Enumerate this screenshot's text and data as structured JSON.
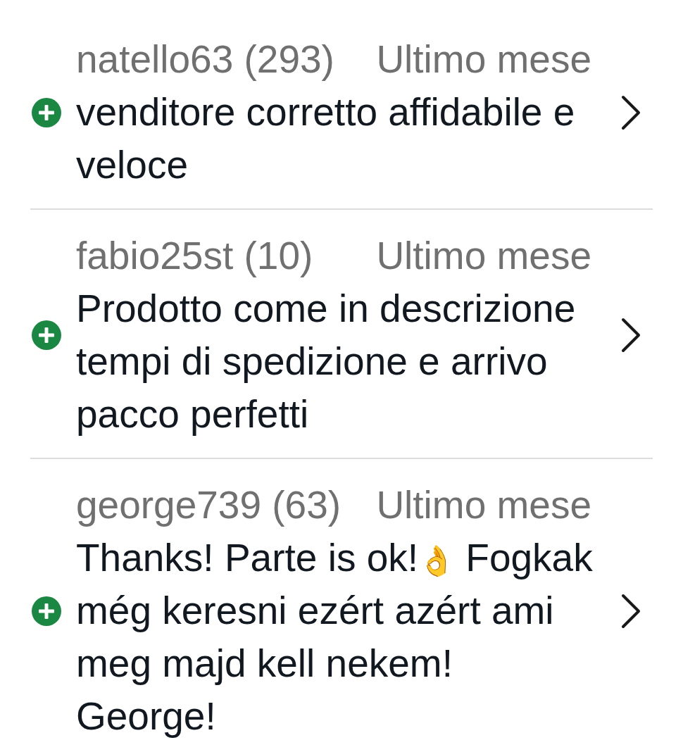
{
  "reviews": [
    {
      "positive": true,
      "user": "natello63 (293)",
      "time": "Ultimo mese",
      "comment": "venditore corretto affidabile e veloce"
    },
    {
      "positive": true,
      "user": "fabio25st (10)",
      "time": "Ultimo mese",
      "comment": "Prodotto come in descrizione tempi di spedizione e arrivo pacco perfetti"
    },
    {
      "positive": true,
      "user": "george739 (63)",
      "time": "Ultimo mese",
      "comment": "Thanks! Parte is ok!👌 Fogkak még keresni ezért azért ami meg majd kell nekem! George!"
    }
  ]
}
